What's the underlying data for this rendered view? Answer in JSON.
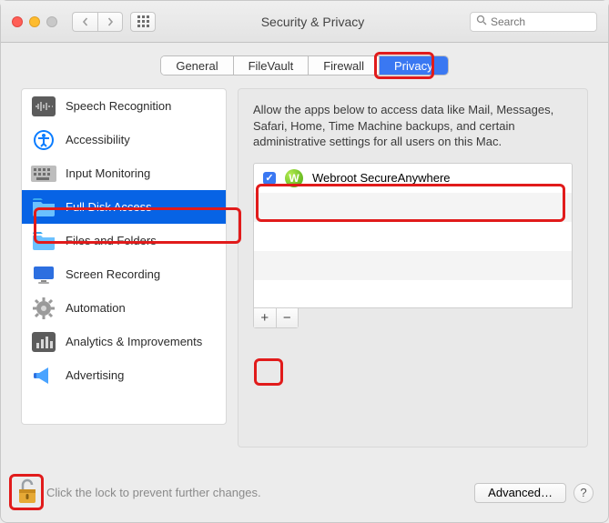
{
  "window": {
    "title": "Security & Privacy"
  },
  "search": {
    "placeholder": "Search"
  },
  "tabs": [
    {
      "label": "General"
    },
    {
      "label": "FileVault"
    },
    {
      "label": "Firewall"
    },
    {
      "label": "Privacy",
      "active": true
    }
  ],
  "categories": [
    {
      "label": "Speech Recognition",
      "icon": "waveform-icon"
    },
    {
      "label": "Accessibility",
      "icon": "accessibility-icon"
    },
    {
      "label": "Input Monitoring",
      "icon": "keyboard-icon"
    },
    {
      "label": "Full Disk Access",
      "icon": "folder-icon",
      "active": true
    },
    {
      "label": "Files and Folders",
      "icon": "folder-icon"
    },
    {
      "label": "Screen Recording",
      "icon": "display-icon"
    },
    {
      "label": "Automation",
      "icon": "gear-icon"
    },
    {
      "label": "Analytics & Improvements",
      "icon": "chart-icon"
    },
    {
      "label": "Advertising",
      "icon": "megaphone-icon"
    }
  ],
  "panel": {
    "description": "Allow the apps below to access data like Mail, Messages, Safari, Home, Time Machine backups, and certain administrative settings for all users on this Mac.",
    "apps": [
      {
        "name": "Webroot SecureAnywhere",
        "checked": true,
        "badge": "W"
      }
    ],
    "add_label": "+",
    "remove_label": "−"
  },
  "footer": {
    "lock_text": "Click the lock to prevent further changes.",
    "advanced_label": "Advanced…",
    "help_label": "?"
  }
}
